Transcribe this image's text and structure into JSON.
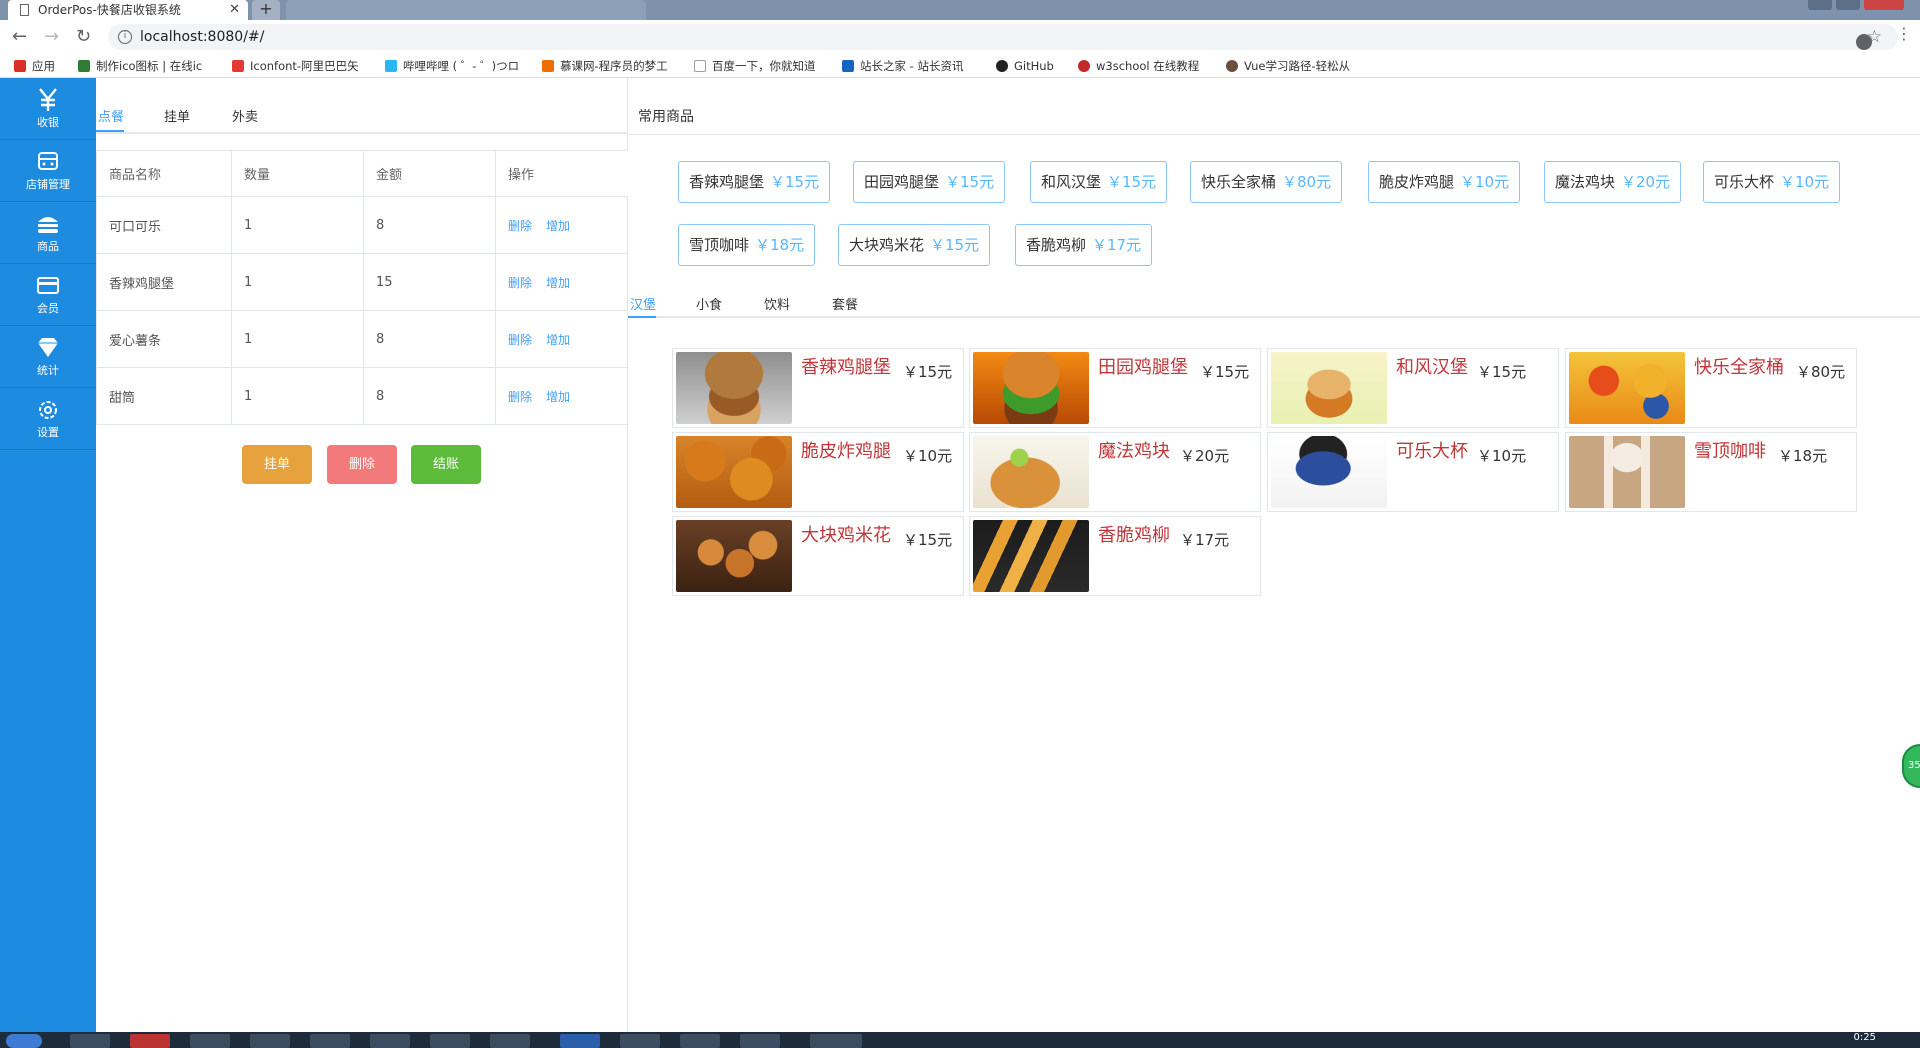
{
  "browser": {
    "tab_title": "OrderPos-快餐店收银系统",
    "tab_close": "✕",
    "new_tab": "+",
    "url": "localhost:8080/#/",
    "bookmarks": [
      {
        "label": "应用",
        "color": "#d93025"
      },
      {
        "label": "制作ico图标 | 在线ic",
        "color": "#2e7d32"
      },
      {
        "label": "Iconfont-阿里巴巴矢",
        "color": "#e53935"
      },
      {
        "label": "哔哩哔哩 ( ゜- ゜)つロ",
        "color": "#29b6f6"
      },
      {
        "label": "慕课网-程序员的梦工",
        "color": "#ef6c00"
      },
      {
        "label": "百度一下，你就知道",
        "color": "#9e9e9e"
      },
      {
        "label": "站长之家 - 站长资讯",
        "color": "#1565c0"
      },
      {
        "label": "GitHub",
        "color": "#222222"
      },
      {
        "label": "w3school 在线教程",
        "color": "#c62828"
      },
      {
        "label": "Vue学习路径-轻松从",
        "color": "#6d4c41"
      }
    ]
  },
  "sidebar": {
    "items": [
      {
        "label": "收银",
        "icon": "yen-icon"
      },
      {
        "label": "店铺管理",
        "icon": "shop-icon"
      },
      {
        "label": "商品",
        "icon": "burger-icon"
      },
      {
        "label": "会员",
        "icon": "card-icon"
      },
      {
        "label": "统计",
        "icon": "diamond-icon"
      },
      {
        "label": "设置",
        "icon": "gear-icon"
      }
    ]
  },
  "order": {
    "tabs": [
      "点餐",
      "挂单",
      "外卖"
    ],
    "columns": [
      "商品名称",
      "数量",
      "金额",
      "操作"
    ],
    "rows": [
      {
        "name": "可口可乐",
        "qty": "1",
        "amount": "8"
      },
      {
        "name": "香辣鸡腿堡",
        "qty": "1",
        "amount": "15"
      },
      {
        "name": "爱心薯条",
        "qty": "1",
        "amount": "8"
      },
      {
        "name": "甜筒",
        "qty": "1",
        "amount": "8"
      }
    ],
    "op_delete": "删除",
    "op_add": "增加",
    "buttons": {
      "hang": "挂单",
      "delete": "删除",
      "checkout": "结账"
    }
  },
  "common": {
    "title": "常用商品",
    "items": [
      {
        "name": "香辣鸡腿堡",
        "price": "￥15元"
      },
      {
        "name": "田园鸡腿堡",
        "price": "￥15元"
      },
      {
        "name": "和风汉堡",
        "price": "￥15元"
      },
      {
        "name": "快乐全家桶",
        "price": "￥80元"
      },
      {
        "name": "脆皮炸鸡腿",
        "price": "￥10元"
      },
      {
        "name": "魔法鸡块",
        "price": "￥20元"
      },
      {
        "name": "可乐大杯",
        "price": "￥10元"
      },
      {
        "name": "雪顶咖啡",
        "price": "￥18元"
      },
      {
        "name": "大块鸡米花",
        "price": "￥15元"
      },
      {
        "name": "香脆鸡柳",
        "price": "￥17元"
      }
    ]
  },
  "category": {
    "tabs": [
      "汉堡",
      "小食",
      "饮料",
      "套餐"
    ],
    "goods": [
      {
        "name": "香辣鸡腿堡",
        "price": "￥15元"
      },
      {
        "name": "田园鸡腿堡",
        "price": "￥15元"
      },
      {
        "name": "和风汉堡",
        "price": "￥15元"
      },
      {
        "name": "快乐全家桶",
        "price": "￥80元"
      },
      {
        "name": "脆皮炸鸡腿",
        "price": "￥10元"
      },
      {
        "name": "魔法鸡块",
        "price": "￥20元"
      },
      {
        "name": "可乐大杯",
        "price": "￥10元"
      },
      {
        "name": "雪顶咖啡",
        "price": "￥18元"
      },
      {
        "name": "大块鸡米花",
        "price": "￥15元"
      },
      {
        "name": "香脆鸡柳",
        "price": "￥17元"
      }
    ]
  },
  "float_badge": "35",
  "clock": "0:25",
  "colors": {
    "sidebar": "#1d8ce0",
    "accent": "#409eff",
    "goods_name": "#c03639"
  }
}
